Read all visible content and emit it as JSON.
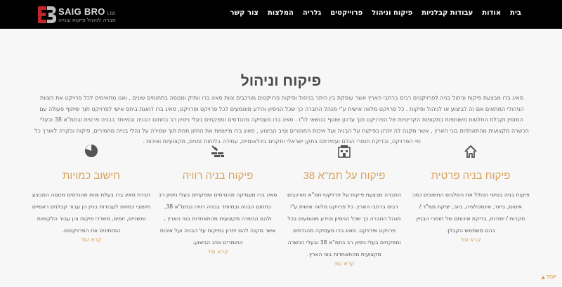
{
  "header": {
    "logo_text": "SAIG BRO",
    "logo_ltd": "Ltd",
    "logo_tagline": "חברה לניהול פיקוח ובנייה",
    "nav": [
      "בית",
      "אודות",
      "עבודות קבלניות",
      "פיקוח וניהול",
      "פרוייקטים",
      "גלריה",
      "המלצות",
      "צור קשר"
    ]
  },
  "main": {
    "title": "פיקוח וניהול",
    "intro": "סאיג ברו מבצעת פיקוח וניהול בניה לפרויקטים רבים ברחבי הארץ אשר עוסקת בין היתר בניהול ופיקוח פרויקטים מורכבים צוות סאיג ברו וותיק ומנוסה בתחומים שונים , ואנו מתאימים לכל פרויקט את הצוות הניהולי המתאים אם זה לביצוע או לניהול ופיקוח . כל פרויקט מלווה אישית ע\"י מנהל החברה כך שכל הניסיון והידע מוטמעים לכל פרויקט ופרויקט, סאיג ברו דואגת ביחס אישי לפרויקט תוך שיתוף פעולה עם המזמין וקבלת החלטות משותפות בתקופות הקריטיות של הפרויקט תוך עדכון שוטף בנושאי לו\"ז . סאיג ברו מעסיקה מהנדסים ומפקחים בעלי ניסיון רב בתחום הבניה ובמיוחד בבניה פרטית ובתמ\"א 38 ובעלי הכשרה מקצועית מהתאחדות בוני הארץ , אשר מקנה לה יתרון בפיקוח על הבניה ועל איכות החומרים וטיב הביצוע , סאיג ברו מיישמת את החזון תחת תוך שמירה על נהלי בנייה מחמירים, פיקוח ובקרה לאורך כל חיי הפרויקט, ובדיקת חומרי הגלם ועמידתם בתקן ישראלי ותקנים בינלאומיים, עמידה בלוחות זמנים, מקצועיות ואיכות .",
    "read_more": "קרא עוד",
    "services": [
      {
        "icon": "house-icon",
        "title": "פיקוח בניה פרטית",
        "text": "פיקוח בניה בסיסי הכולל את השלבים החשובים כמו: איטום, ביזוד, אינסטלציה, ביוב, יציקת ממ\"ד / תקרות / יסודות, בדיקת איכותם של חומרי הבניין בהם משתמש הקבלן."
      },
      {
        "icon": "building-38-icon",
        "title": "פיקוח על תמ\"א 38",
        "text": "החברה מבצעת פיקוח על פרויקטי תמ\"א מורכבים רבים ברחבי הארץ. כל פרויקט מלווה אישית ע\"י מנהל החברה כך שכל הניסיון והידע מוטמעים בכל פרויקט ופרויקט. סאיג ברו מעסיקה מהנדסים ומפקחים בעלי ניסיון רב בתמ\"א 38 ובעלי הכשרה מקצועית מהתאחדות בוני הארץ."
      },
      {
        "icon": "bricks-icon",
        "title": "פיקוח בניה רוויה",
        "text": "סאיג ברו מעסיקה מהנדסים ומפקחים בעלי ניסיון רב בתחום הבניה ובמיוחד בבניה רוויה ובתמ\"א 38, ולהם הכשרה מקצועית מהתאחדות בוני הארץ , אשר מקנה להם יתרון בפיקוח על הבניה ועל איכות החומרים וטיב הביצוע."
      },
      {
        "icon": "pie-chart-icon",
        "title": "חישוב כמויות",
        "text": "חברת סאיג ברו בעלת צוות מהנדסים מנוסה המבצע חישובי כמויות לעבודות בניין הן עבור קבלנים ראשיים ומשניים, יזמים, משרדי פיקוח והן עבור הלקוחות המזמינים את הפרויקטים."
      }
    ]
  },
  "footer": {
    "top_link": "TOP"
  },
  "colors": {
    "accent": "#d8a25c",
    "nav_bg": "#000000",
    "page_bg": "#f7f7f7"
  }
}
